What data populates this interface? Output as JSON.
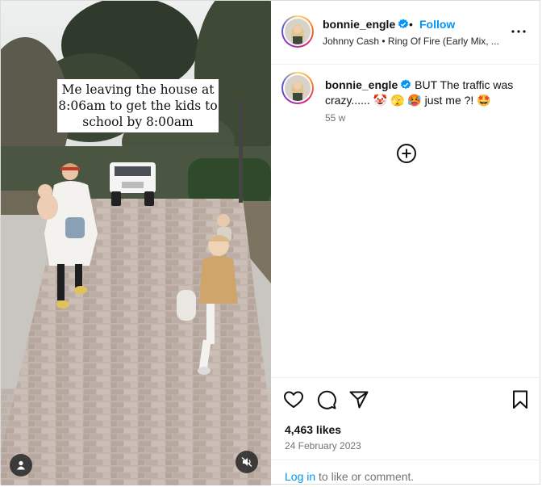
{
  "media": {
    "caption_lines": [
      "Me leaving the house at",
      "8:06am to get the kids to",
      "school by 8:00am"
    ]
  },
  "header": {
    "username": "bonnie_engle",
    "separator": "•",
    "follow_label": "Follow",
    "audio": "Johnny Cash • Ring Of Fire (Early Mix, ..."
  },
  "comment": {
    "username": "bonnie_engle",
    "text": "BUT The traffic was crazy...... 🤡 🫣 🥵 just me ?! 🤩",
    "age": "55 w"
  },
  "post": {
    "likes": "4,463 likes",
    "date": "24 February 2023"
  },
  "footer": {
    "login_link": "Log in",
    "login_suffix": " to like or comment."
  },
  "colors": {
    "accent": "#0095f6",
    "verified": "#0095f6",
    "muted_text": "#737373"
  },
  "icons": [
    "verified-badge-icon",
    "more-options-icon",
    "add-comment-icon",
    "heart-icon",
    "comment-icon",
    "share-icon",
    "bookmark-icon",
    "user-tag-icon",
    "muted-audio-icon"
  ]
}
